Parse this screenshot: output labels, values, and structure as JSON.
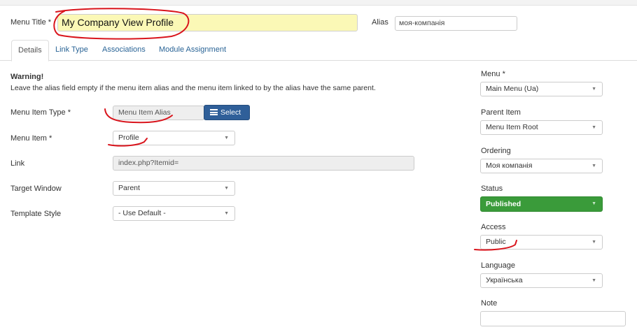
{
  "header": {
    "menu_title_label": "Menu Title *",
    "menu_title_value": "My Company View Profile",
    "alias_label": "Alias",
    "alias_value": "моя-компанія"
  },
  "tabs": [
    {
      "label": "Details",
      "active": true
    },
    {
      "label": "Link Type"
    },
    {
      "label": "Associations"
    },
    {
      "label": "Module Assignment"
    }
  ],
  "warning": {
    "title": "Warning!",
    "text": "Leave the alias field empty if the menu item alias and the menu item linked to by the alias have the same parent."
  },
  "form": {
    "menu_item_type_label": "Menu Item Type *",
    "menu_item_type_value": "Menu Item Alias",
    "select_button": "Select",
    "menu_item_label": "Menu Item *",
    "menu_item_value": "Profile",
    "link_label": "Link",
    "link_value": "index.php?Itemid=",
    "target_window_label": "Target Window",
    "target_window_value": "Parent",
    "template_style_label": "Template Style",
    "template_style_value": "- Use Default -"
  },
  "sidebar": {
    "menu_label": "Menu *",
    "menu_value": "Main Menu (Ua)",
    "parent_label": "Parent Item",
    "parent_value": "Menu Item Root",
    "ordering_label": "Ordering",
    "ordering_value": "Моя компанія",
    "status_label": "Status",
    "status_value": "Published",
    "access_label": "Access",
    "access_value": "Public",
    "language_label": "Language",
    "language_value": "Українська",
    "note_label": "Note",
    "note_value": ""
  },
  "colors": {
    "title_highlight": "#fbf8b6",
    "select_button": "#2f5f99",
    "status_published": "#3a9b3a",
    "annotation_ink": "#d9141c"
  }
}
